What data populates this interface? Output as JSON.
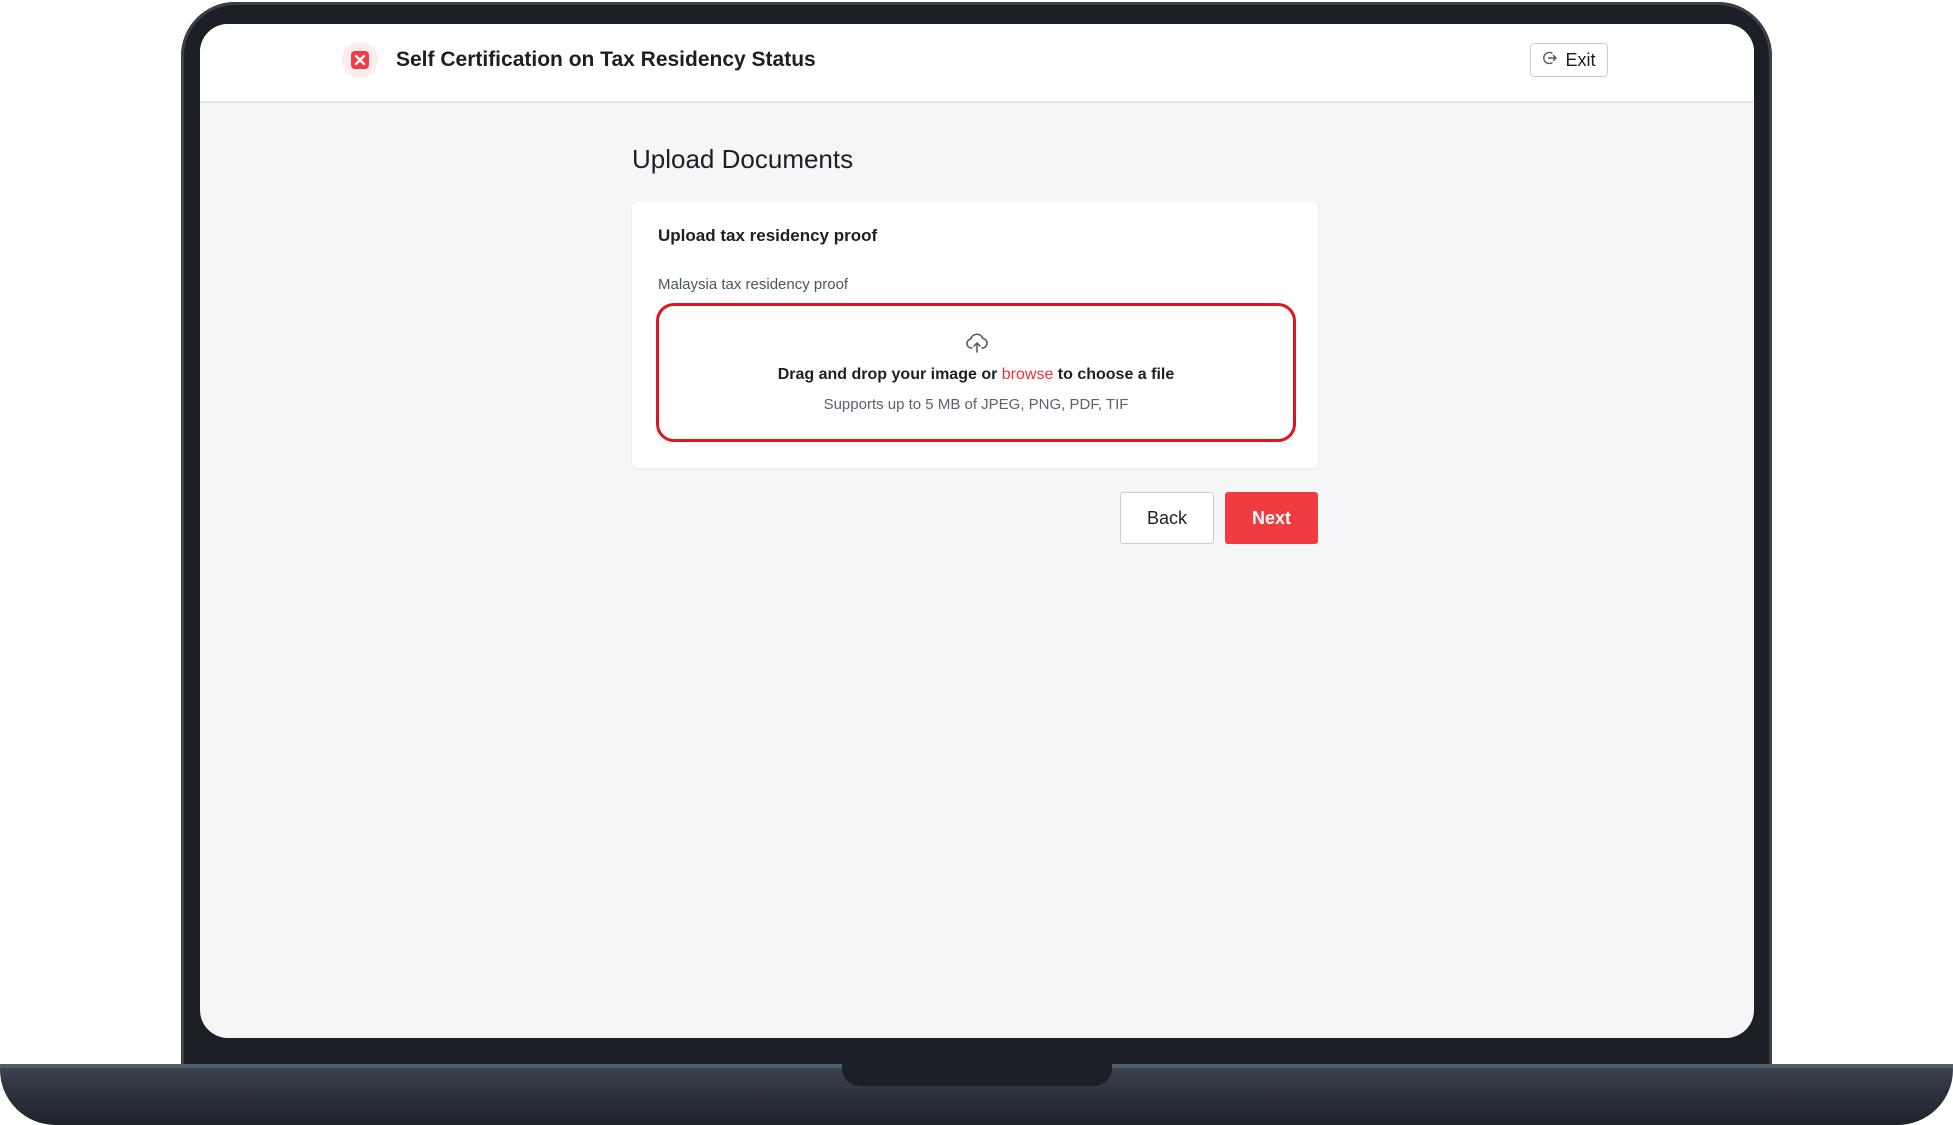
{
  "app": {
    "title": "Self Certification on Tax Residency Status",
    "exit_label": "Exit",
    "brand_color": "#f03b40"
  },
  "page": {
    "title": "Upload Documents"
  },
  "upload_card": {
    "title": "Upload tax residency proof",
    "field_label": "Malaysia tax residency proof",
    "dropzone": {
      "text_before": "Drag and drop your image or ",
      "browse_label": "browse",
      "text_after": " to choose a file",
      "hint": "Supports up to 5 MB of JPEG, PNG, PDF, TIF",
      "icon": "cloud-upload-icon",
      "highlight_color": "#e0141e"
    }
  },
  "actions": {
    "back_label": "Back",
    "next_label": "Next"
  }
}
